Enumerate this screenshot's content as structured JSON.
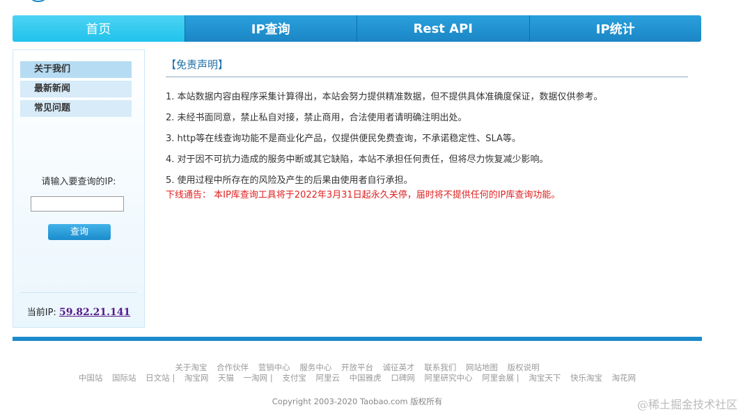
{
  "nav": {
    "items": [
      {
        "label": "首页",
        "active": true
      },
      {
        "label": "IP查询",
        "active": false
      },
      {
        "label": "Rest API",
        "active": false
      },
      {
        "label": "IP统计",
        "active": false
      }
    ]
  },
  "sidebar": {
    "items": [
      {
        "label": "关于我们"
      },
      {
        "label": "最新新闻"
      },
      {
        "label": "常见问题"
      }
    ],
    "query_label": "请输入要查询的IP:",
    "query_input_value": "",
    "query_button": "查询",
    "current_ip_label": "当前IP:",
    "current_ip_value": "59.82.21.141"
  },
  "main": {
    "title": "【免责声明】",
    "notices": [
      "1. 本站数据内容由程序采集计算得出，本站会努力提供精准数据，但不提供具体准确度保证，数据仅供参考。",
      "2. 未经书面同意，禁止私自对接，禁止商用，合法使用者请明确注明出处。",
      "3. http等在线查询功能不是商业化产品，仅提供便民免费查询，不承诺稳定性、SLA等。",
      "4. 对于因不可抗力造成的服务中断或其它缺陷，本站不承担任何责任，但将尽力恢复减少影响。",
      "5. 使用过程中所存在的风险及产生的后果由使用者自行承担。"
    ],
    "warning": "下线通告：  本IP库查询工具将于2022年3月31日起永久关停，届时将不提供任何的IP库查询功能。"
  },
  "footer": {
    "links_row1": [
      "关于淘宝",
      "合作伙伴",
      "营销中心",
      "服务中心",
      "开放平台",
      "诚征英才",
      "联系我们",
      "网站地图",
      "版权说明"
    ],
    "links_row2": [
      "中国站",
      "国际站",
      "日文站",
      "淘宝网",
      "天猫",
      "一淘网",
      "支付宝",
      "阿里云",
      "中国雅虎",
      "口碑网",
      "阿里研究中心",
      "阿里会展",
      "淘宝天下",
      "快乐淘宝",
      "淘花网"
    ],
    "copyright": "Copyright 2003-2020 Taobao.com 版权所有"
  },
  "watermark": "@稀土掘金技术社区",
  "colors": {
    "nav_active": "#21c2ec",
    "nav_default": "#1b86c5",
    "title": "#2170a8",
    "warning": "#e02020",
    "bar": "#1d8acb"
  }
}
